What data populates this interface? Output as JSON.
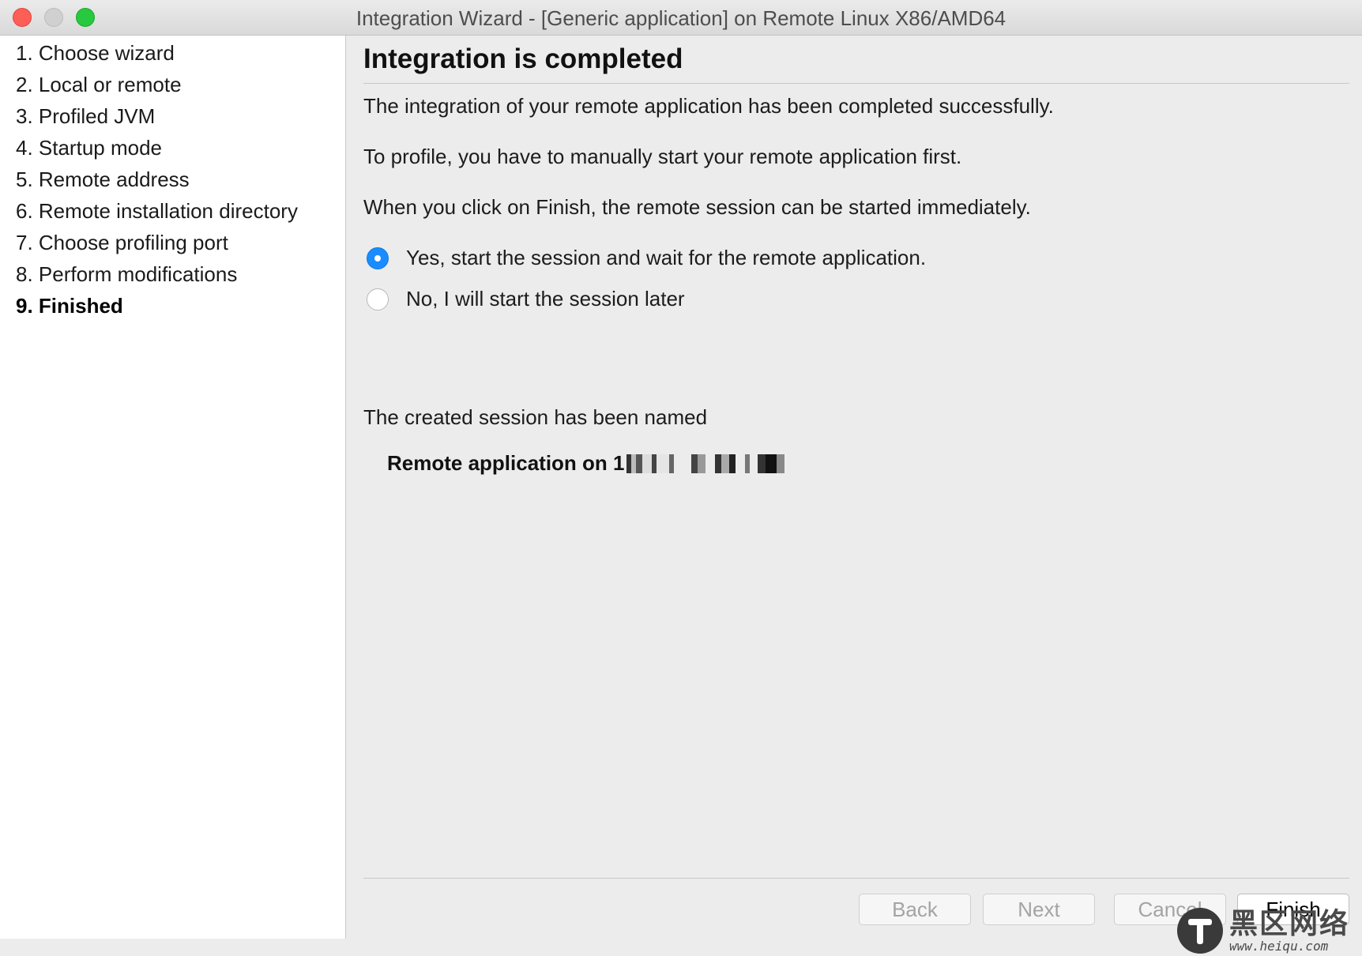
{
  "window": {
    "title": "Integration Wizard - [Generic application] on Remote Linux X86/AMD64"
  },
  "sidebar": {
    "steps": [
      {
        "label": "1. Choose wizard",
        "active": false
      },
      {
        "label": "2. Local or remote",
        "active": false
      },
      {
        "label": "3. Profiled JVM",
        "active": false
      },
      {
        "label": "4. Startup mode",
        "active": false
      },
      {
        "label": "5. Remote address",
        "active": false
      },
      {
        "label": "6. Remote installation directory",
        "active": false
      },
      {
        "label": "7. Choose profiling port",
        "active": false
      },
      {
        "label": "8. Perform modifications",
        "active": false
      },
      {
        "label": "9. Finished",
        "active": true
      }
    ]
  },
  "main": {
    "heading": "Integration is completed",
    "para1": "The integration of your remote application has been completed successfully.",
    "para2": "To profile, you have to manually start your remote application first.",
    "para3": "When you click on Finish, the remote session can be started immediately.",
    "options": [
      {
        "label": "Yes, start the session and wait for the remote application.",
        "selected": true
      },
      {
        "label": "No, I will start the session later",
        "selected": false
      }
    ],
    "session_intro": "The created session has been named",
    "session_name": "Remote application on 1"
  },
  "buttons": {
    "back": "Back",
    "next": "Next",
    "cancel": "Cancel",
    "finish": "Finish"
  },
  "watermark": {
    "cn": "黑区网络",
    "url": "www.heiqu.com"
  },
  "colors": {
    "accent": "#1a8cff",
    "close": "#fd5f57",
    "maximize": "#28c840"
  }
}
